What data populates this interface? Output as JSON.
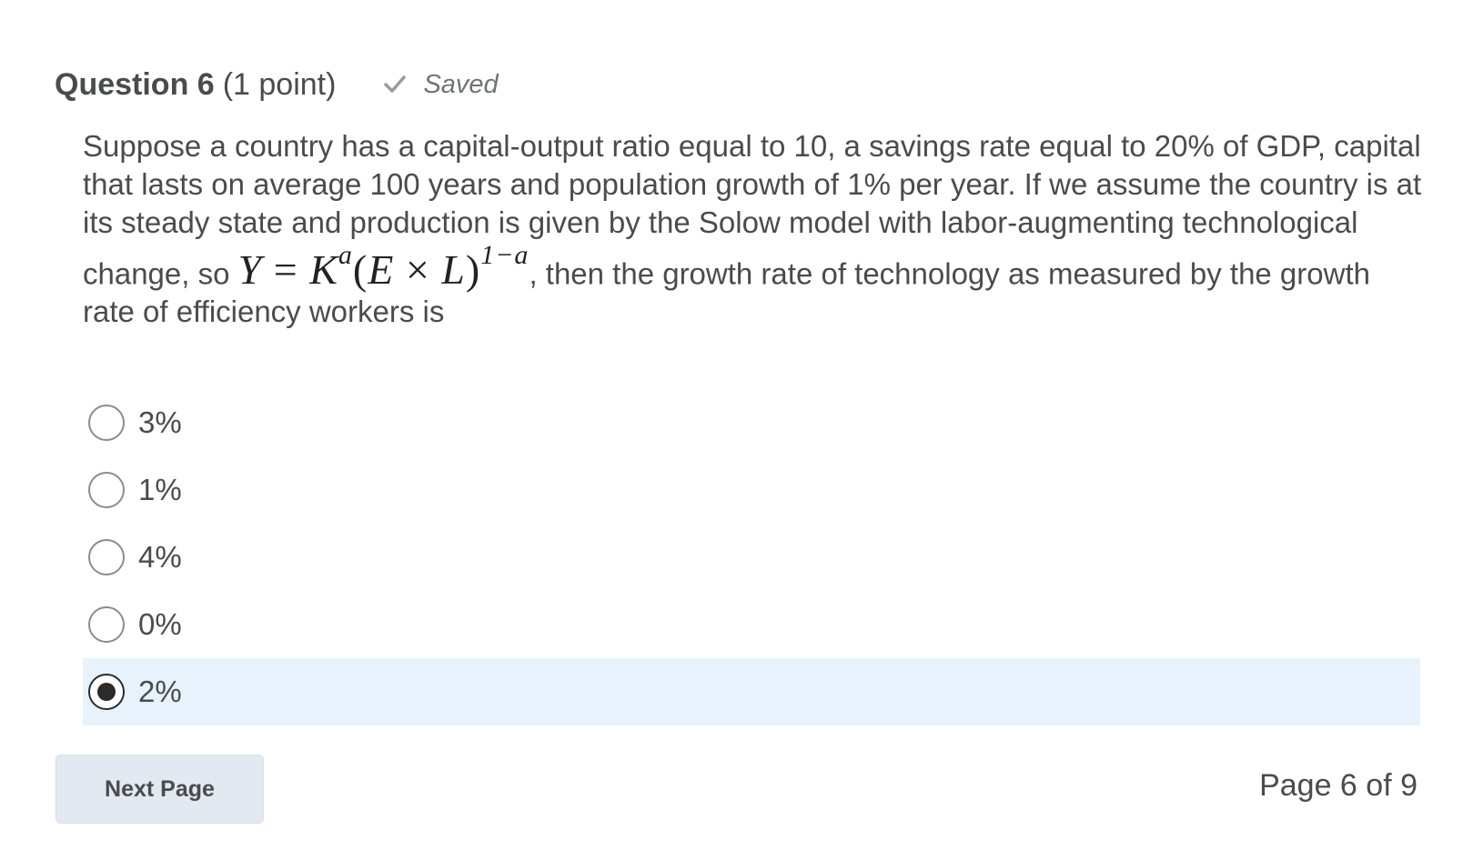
{
  "question": {
    "title": "Question 6",
    "points": "(1 point)",
    "saved_label": "Saved",
    "saved_icon": "check-icon",
    "text_part1": "Suppose a country has a capital-output ratio equal to 10, a savings rate equal to 20% of GDP, capital that lasts on average 100 years and population growth of 1% per year. If we assume the country is at its steady state and production is given by the Solow model with labor-augmenting technological change, so",
    "formula": {
      "lhs": "Y",
      "eq": "=",
      "k": "K",
      "k_exp": "a",
      "paren_open": "(",
      "e": "E",
      "times": "×",
      "l": "L",
      "paren_close": ")",
      "outer_exp": "1−a"
    },
    "text_part2": ", then the growth rate of technology as measured by the growth rate of efficiency workers is"
  },
  "options": [
    {
      "label": "3%",
      "selected": false
    },
    {
      "label": "1%",
      "selected": false
    },
    {
      "label": "4%",
      "selected": false
    },
    {
      "label": "0%",
      "selected": false
    },
    {
      "label": "2%",
      "selected": true
    }
  ],
  "footer": {
    "next_button_label": "Next Page",
    "page_indicator": "Page 6 of 9"
  },
  "colors": {
    "text": "#494c4e",
    "selected_background": "#e8f2fc",
    "button_background": "#e3e9f1"
  }
}
